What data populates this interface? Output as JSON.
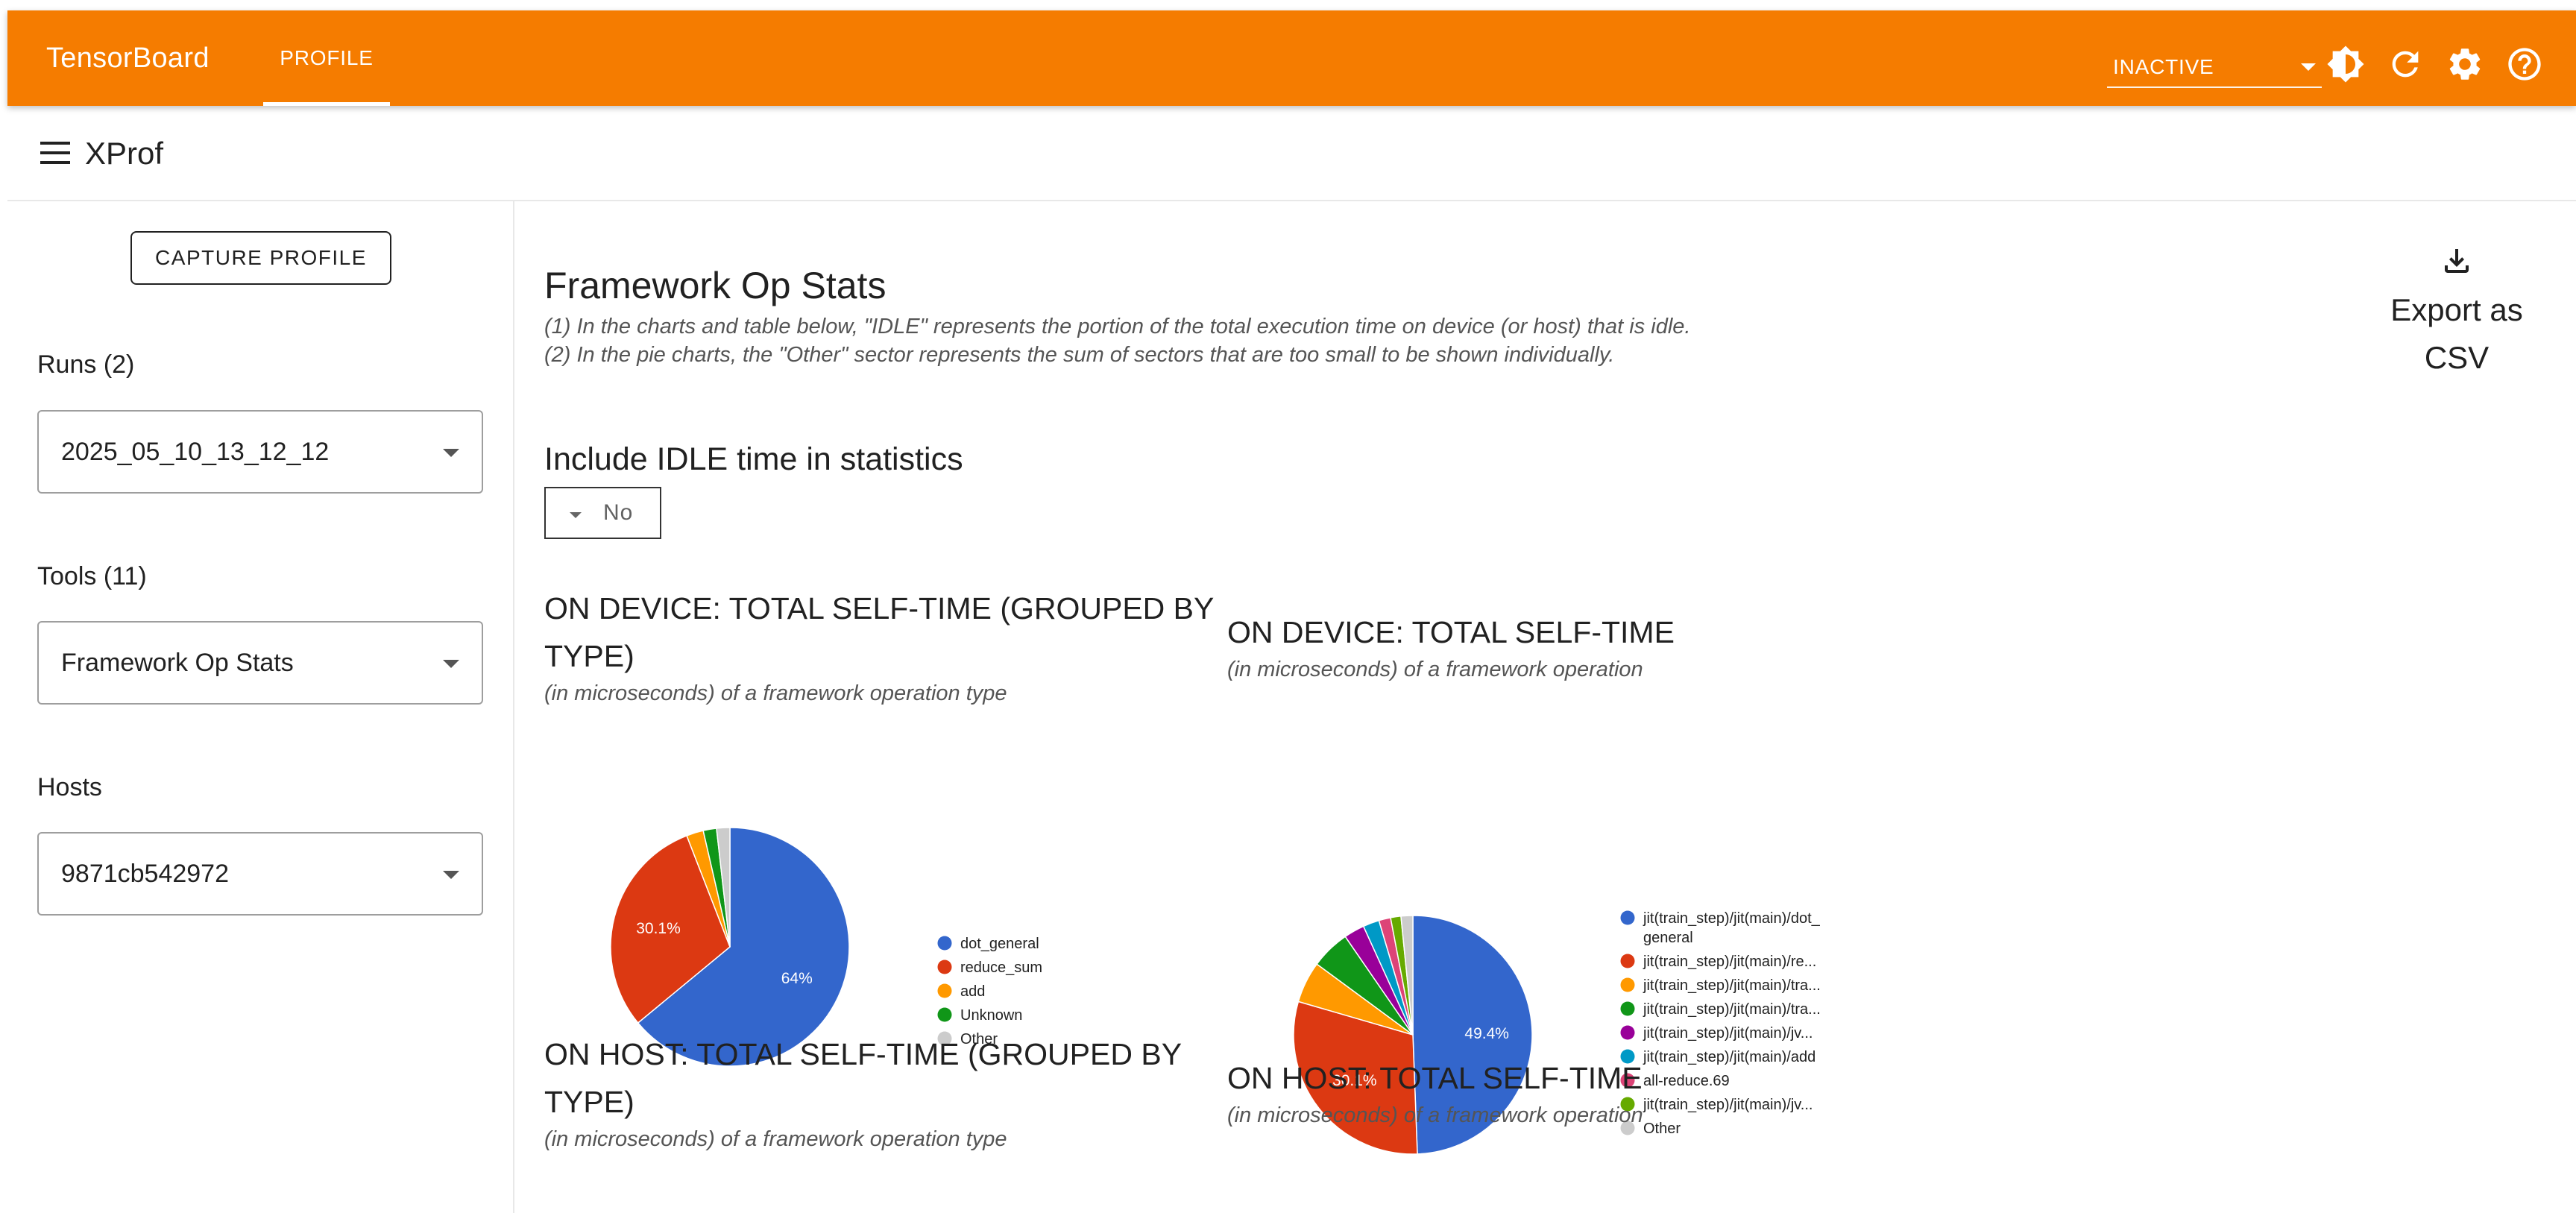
{
  "header": {
    "brand": "TensorBoard",
    "tab_profile": "PROFILE",
    "run_status": "INACTIVE",
    "icons": [
      "brightness-icon",
      "refresh-icon",
      "settings-icon",
      "help-icon"
    ],
    "accent_color": "#f57c00"
  },
  "subbar": {
    "title": "XProf"
  },
  "sidebar": {
    "capture_label": "CAPTURE PROFILE",
    "runs_label": "Runs (2)",
    "runs_value": "2025_05_10_13_12_12",
    "tools_label": "Tools (11)",
    "tools_value": "Framework Op Stats",
    "hosts_label": "Hosts",
    "hosts_value": "9871cb542972"
  },
  "main": {
    "title": "Framework Op Stats",
    "note1": "(1) In the charts and table below, \"IDLE\" represents the portion of the total execution time on device (or host) that is idle.",
    "note2": "(2) In the pie charts, the \"Other\" sector represents the sum of sectors that are too small to be shown individually.",
    "export_line1": "Export as",
    "export_line2": "CSV",
    "idle_title": "Include IDLE time in statistics",
    "idle_value": "No",
    "charts": {
      "device_type": {
        "title_line1": "ON DEVICE: TOTAL SELF-TIME (GROUPED BY",
        "title_line2": "TYPE)",
        "subtitle": "(in microseconds) of a framework operation type"
      },
      "device_op": {
        "title": "ON DEVICE: TOTAL SELF-TIME",
        "subtitle": "(in microseconds) of a framework operation"
      },
      "host_type": {
        "title_line1": "ON HOST: TOTAL SELF-TIME (GROUPED BY",
        "title_line2": "TYPE)",
        "subtitle": "(in microseconds) of a framework operation type"
      },
      "host_op": {
        "title": "ON HOST: TOTAL SELF-TIME",
        "subtitle": "(in microseconds) of a framework operation"
      }
    }
  },
  "chart_data": [
    {
      "type": "pie",
      "title": "ON DEVICE: TOTAL SELF-TIME (GROUPED BY TYPE)",
      "slices": [
        {
          "label": "dot_general",
          "value": 64.0,
          "color": "#3366cc",
          "display": "64%"
        },
        {
          "label": "reduce_sum",
          "value": 30.1,
          "color": "#dc3912",
          "display": "30.1%"
        },
        {
          "label": "add",
          "value": 2.3,
          "color": "#ff9900",
          "display": ""
        },
        {
          "label": "Unknown",
          "value": 1.8,
          "color": "#109618",
          "display": ""
        },
        {
          "label": "Other",
          "value": 1.8,
          "color": "#cccccc",
          "display": ""
        }
      ],
      "legend_position": "right"
    },
    {
      "type": "pie",
      "title": "ON DEVICE: TOTAL SELF-TIME",
      "slices": [
        {
          "label": "jit(train_step)/jit(main)/dot_general",
          "legend_line1": "jit(train_step)/jit(main)/dot_",
          "legend_line2": "general",
          "value": 49.4,
          "color": "#3366cc",
          "display": "49.4%"
        },
        {
          "label": "jit(train_step)/jit(main)/re...",
          "value": 30.1,
          "color": "#dc3912",
          "display": "30.1%"
        },
        {
          "label": "jit(train_step)/jit(main)/tra...",
          "value": 5.6,
          "color": "#ff9900",
          "display": ""
        },
        {
          "label": "jit(train_step)/jit(main)/tra...",
          "value": 5.3,
          "color": "#109618",
          "display": ""
        },
        {
          "label": "jit(train_step)/jit(main)/jv...",
          "value": 2.8,
          "color": "#990099",
          "display": ""
        },
        {
          "label": "jit(train_step)/jit(main)/add",
          "value": 2.2,
          "color": "#0099c6",
          "display": ""
        },
        {
          "label": "all-reduce.69",
          "value": 1.6,
          "color": "#dd4477",
          "display": ""
        },
        {
          "label": "jit(train_step)/jit(main)/jv...",
          "value": 1.4,
          "color": "#66aa00",
          "display": ""
        },
        {
          "label": "Other",
          "value": 1.6,
          "color": "#cccccc",
          "display": ""
        }
      ],
      "legend_position": "right"
    }
  ]
}
